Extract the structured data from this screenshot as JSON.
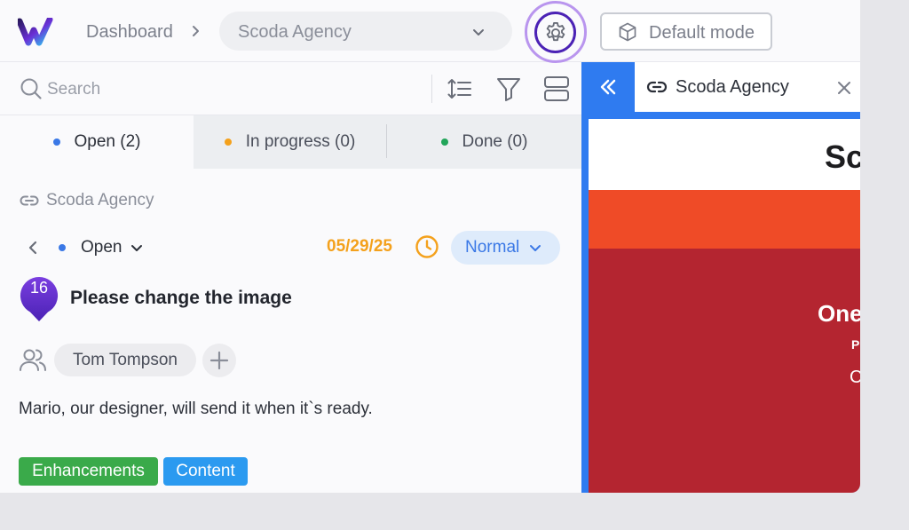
{
  "header": {
    "breadcrumb_root": "Dashboard",
    "project_name": "Scoda Agency",
    "mode_label": "Default mode"
  },
  "toolbar": {
    "search_placeholder": "Search"
  },
  "tabs": [
    {
      "label": "Open (2)",
      "dot_color": "#3a78e6"
    },
    {
      "label": "In progress (0)",
      "dot_color": "#f4a11c"
    },
    {
      "label": "Done (0)",
      "dot_color": "#22a55a"
    }
  ],
  "task": {
    "project_link": "Scoda Agency",
    "status": "Open",
    "status_color": "#3a78e6",
    "due_date": "05/29/25",
    "priority": "Normal",
    "number": "16",
    "title": "Please change the image",
    "assignee": "Tom Tompson",
    "description": "Mario, our designer, will send it when it`s ready.",
    "tags": [
      {
        "label": "Enhancements",
        "color": "#3aaa4a"
      },
      {
        "label": "Content",
        "color": "#2b9af0"
      }
    ]
  },
  "preview": {
    "tab_title": "Scoda Agency",
    "page_heading": "Sc",
    "banner_line1": "One",
    "banner_line2": "P",
    "banner_line3": "C"
  },
  "colors": {
    "accent": "#4b22b5",
    "accent_ring": "#b995ee",
    "preview_border": "#2f7bf0",
    "due_date": "#f4a11c",
    "priority_text": "#3a78e6"
  }
}
